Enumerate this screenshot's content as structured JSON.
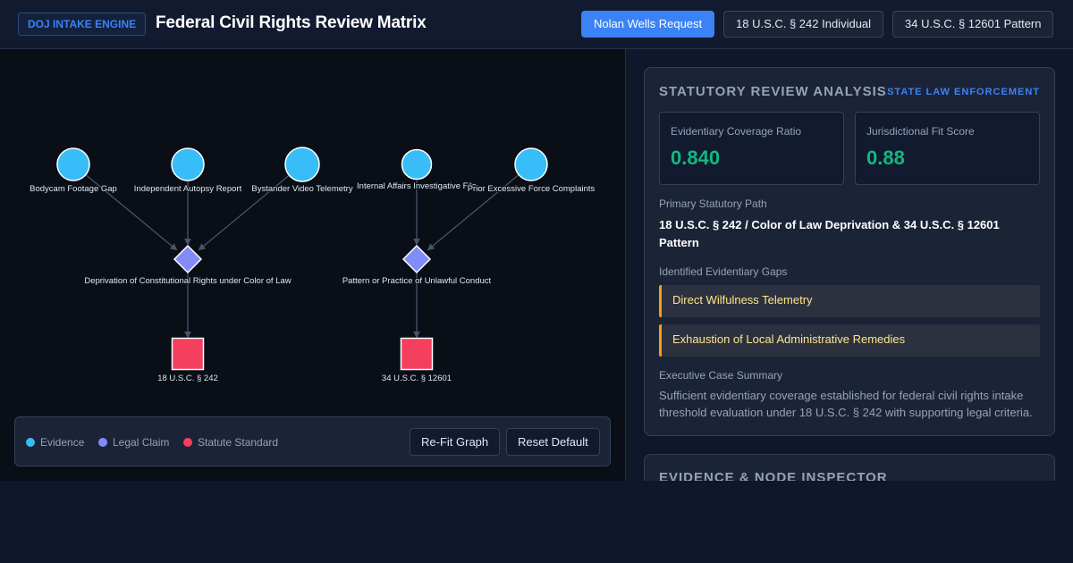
{
  "header": {
    "badge": "DOJ INTAKE ENGINE",
    "title": "Federal Civil Rights Review Matrix",
    "buttons": [
      {
        "label": "Nolan Wells Request",
        "active": true
      },
      {
        "label": "18 U.S.C. § 242 Individual",
        "active": false
      },
      {
        "label": "34 U.S.C. § 12601 Pattern",
        "active": false
      }
    ]
  },
  "colors": {
    "evidence": "#38bdf8",
    "legal_claim": "#818cf8",
    "statute": "#f43f5e",
    "accent": "#3b82f6",
    "metric": "#10b981",
    "gap_border": "#f59e0b"
  },
  "graph": {
    "nodes": [
      {
        "id": "e1",
        "type": "evidence",
        "label": "Bodycam Footage Gap"
      },
      {
        "id": "e2",
        "type": "evidence",
        "label": "Independent Autopsy Report"
      },
      {
        "id": "e3",
        "type": "evidence",
        "label": "Bystander Video Telemetry"
      },
      {
        "id": "e4",
        "type": "evidence",
        "label": "Internal Affairs Investigative File"
      },
      {
        "id": "e5",
        "type": "evidence",
        "label": "Prior Excessive Force Complaints"
      },
      {
        "id": "c1",
        "type": "legal_claim",
        "label": "Deprivation of Constitutional Rights under Color of Law"
      },
      {
        "id": "c2",
        "type": "legal_claim",
        "label": "Pattern or Practice of Unlawful Conduct"
      },
      {
        "id": "s1",
        "type": "statute",
        "label": "18 U.S.C. § 242"
      },
      {
        "id": "s2",
        "type": "statute",
        "label": "34 U.S.C. § 12601"
      }
    ],
    "edges": [
      [
        "e1",
        "c1"
      ],
      [
        "e2",
        "c1"
      ],
      [
        "e3",
        "c1"
      ],
      [
        "e4",
        "c2"
      ],
      [
        "e5",
        "c2"
      ],
      [
        "c1",
        "s1"
      ],
      [
        "c2",
        "s2"
      ]
    ]
  },
  "legend": {
    "evidence": "Evidence",
    "legal_claim": "Legal Claim",
    "statute": "Statute Standard",
    "refit_label": "Re-Fit Graph",
    "reset_label": "Reset Default"
  },
  "analysis": {
    "title": "STATUTORY REVIEW ANALYSIS",
    "tag": "STATE LAW ENFORCEMENT",
    "coverage_label": "Evidentiary Coverage Ratio",
    "coverage_value": "0.840",
    "fit_label": "Jurisdictional Fit Score",
    "fit_value": "0.88",
    "path_label": "Primary Statutory Path",
    "path_value": "18 U.S.C. § 242 / Color of Law Deprivation & 34 U.S.C. § 12601 Pattern",
    "gaps_label": "Identified Evidentiary Gaps",
    "gaps": [
      "Direct Wilfulness Telemetry",
      "Exhaustion of Local Administrative Remedies"
    ],
    "summary_label": "Executive Case Summary",
    "summary": "Sufficient evidentiary coverage established for federal civil rights intake threshold evaluation under 18 U.S.C. § 242 with supporting legal criteria."
  },
  "inspector": {
    "title": "EVIDENCE & NODE INSPECTOR"
  }
}
